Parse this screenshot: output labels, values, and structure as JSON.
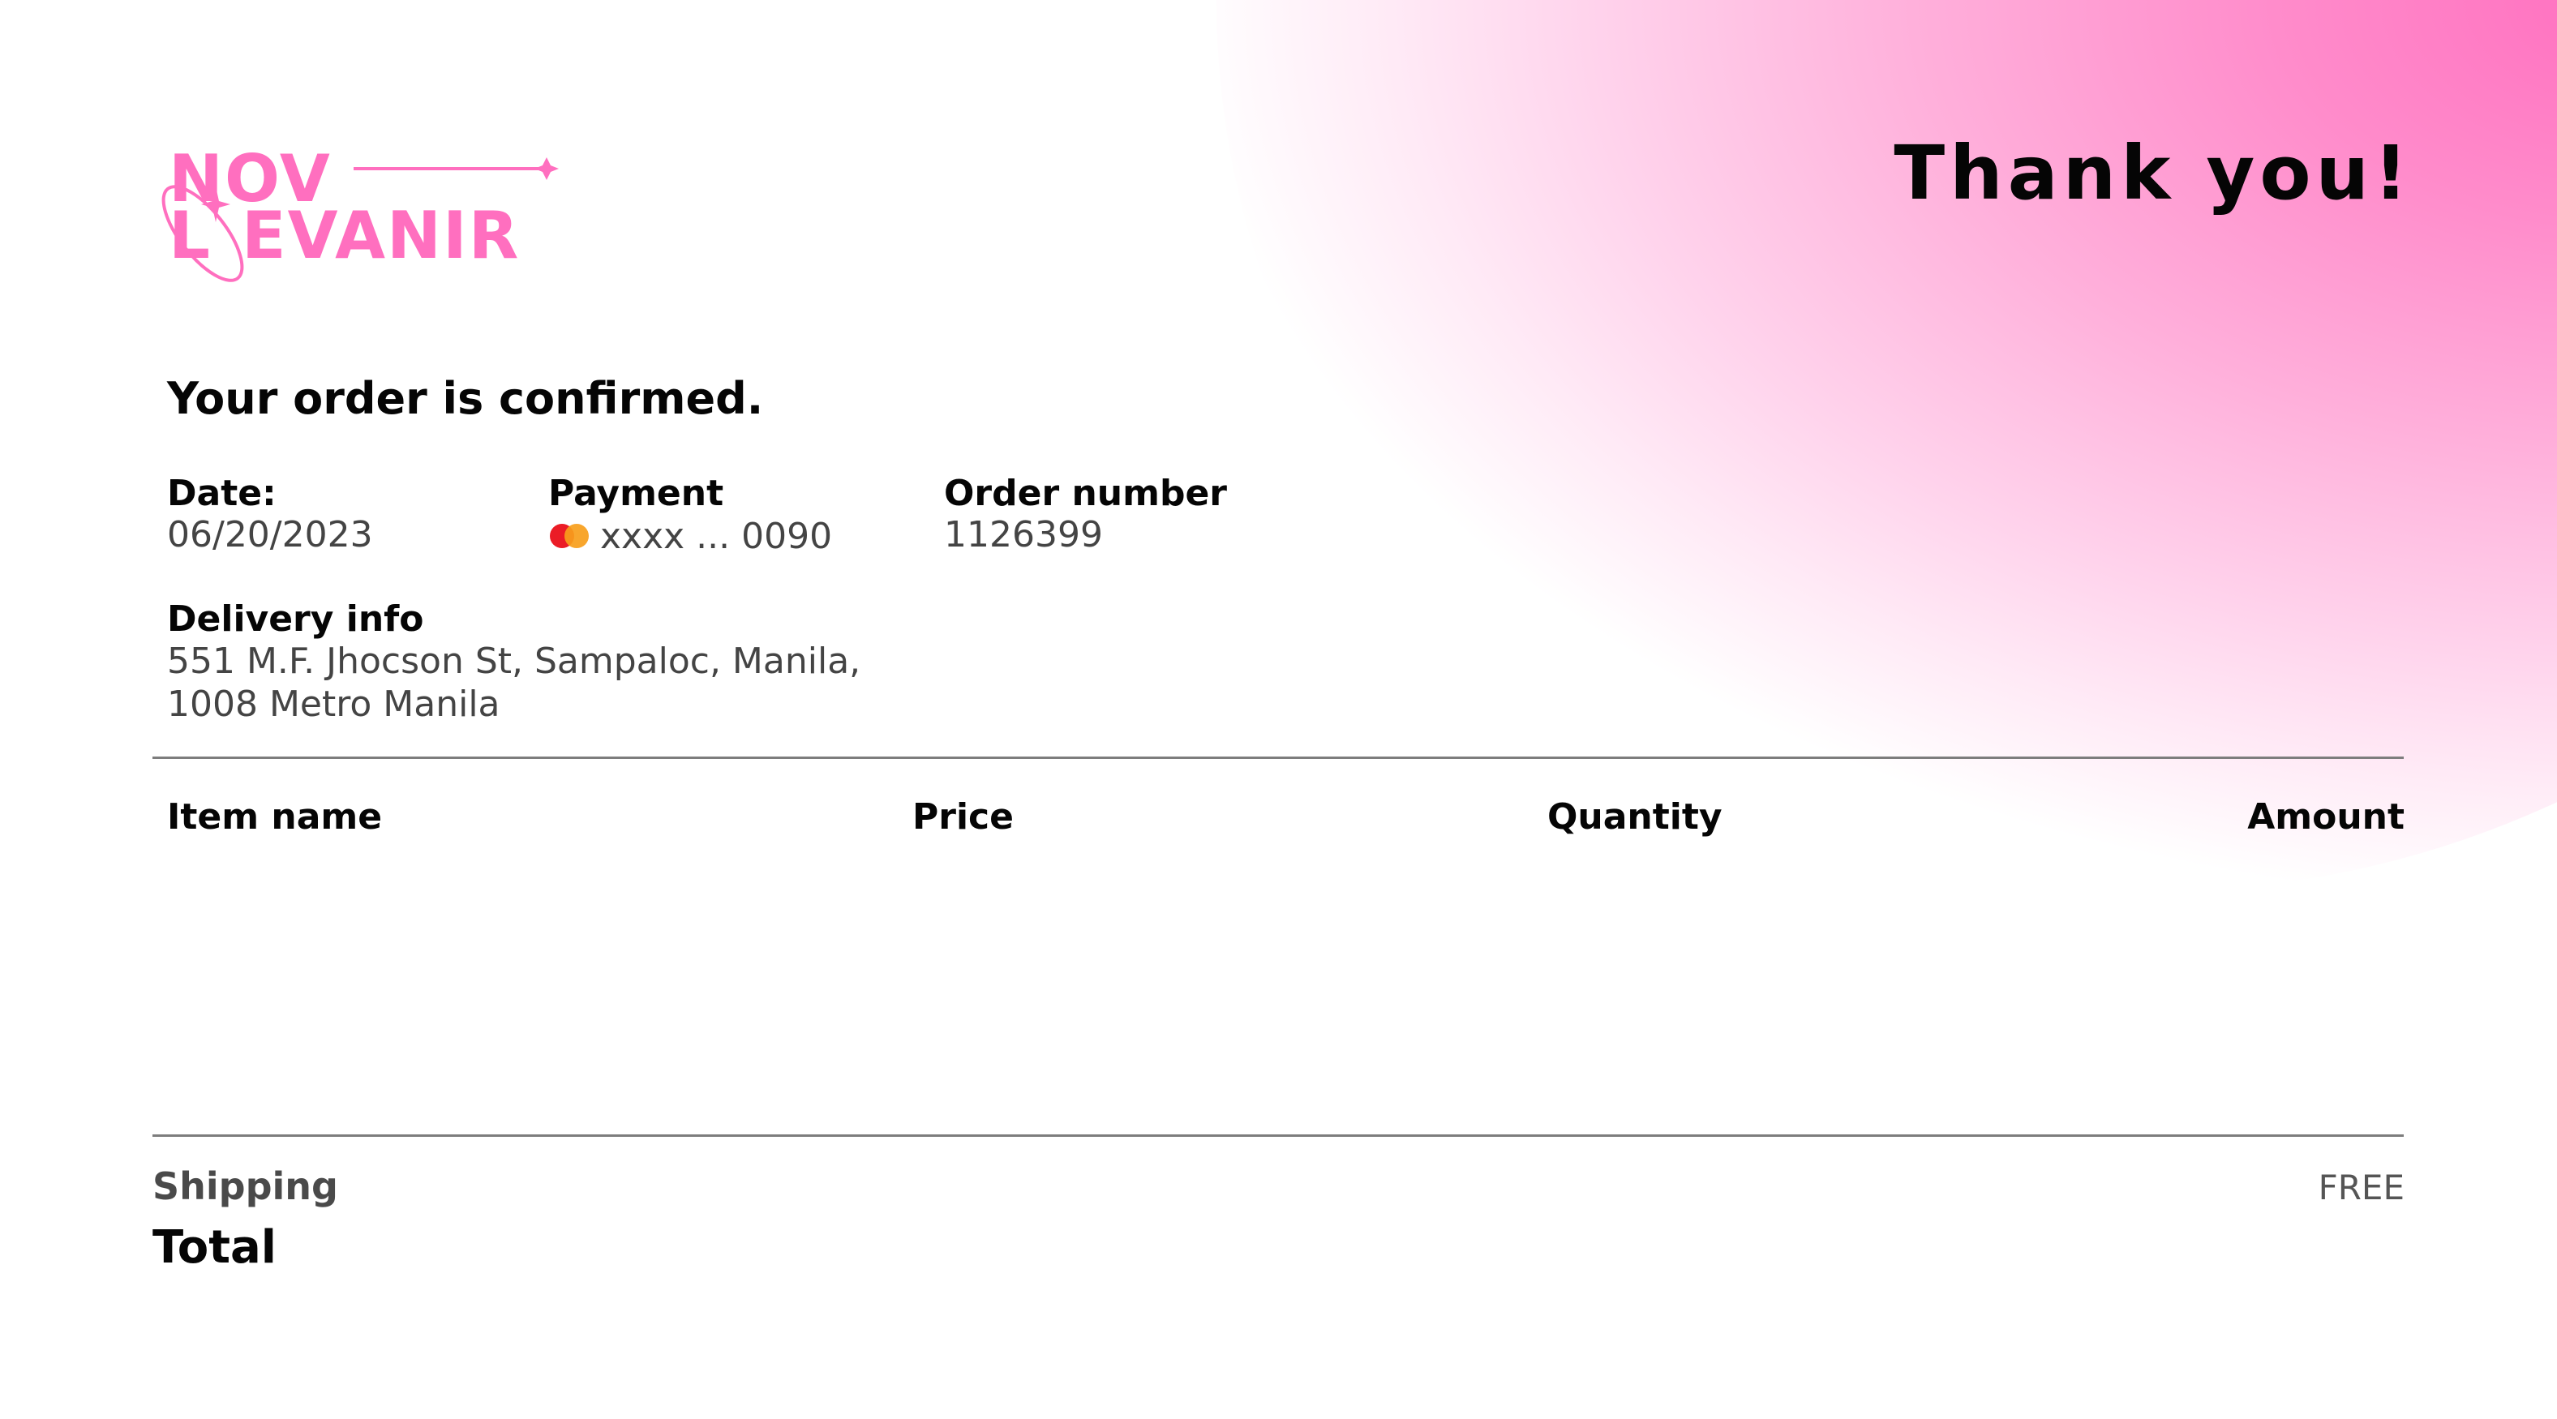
{
  "brand": {
    "logo_line1": "NOV",
    "logo_line2": "L EVANIR",
    "accent_color": "#ff6fbf"
  },
  "header": {
    "thank_you": "Thank you!"
  },
  "order": {
    "heading": "Your order is confirmed.",
    "date_label": "Date:",
    "date_value": "06/20/2023",
    "payment_label": "Payment",
    "payment_value": "xxxx ... 0090",
    "payment_icon": "mastercard-icon",
    "order_number_label": "Order number",
    "order_number_value": "1126399",
    "delivery_label": "Delivery info",
    "delivery_line1": "551 M.F. Jhocson St, Sampaloc, Manila,",
    "delivery_line2": "1008 Metro Manila"
  },
  "table": {
    "columns": [
      "Item name",
      "Price",
      "Quantity",
      "Amount"
    ]
  },
  "summary": {
    "shipping_label": "Shipping",
    "shipping_value": "FREE",
    "total_label": "Total"
  }
}
